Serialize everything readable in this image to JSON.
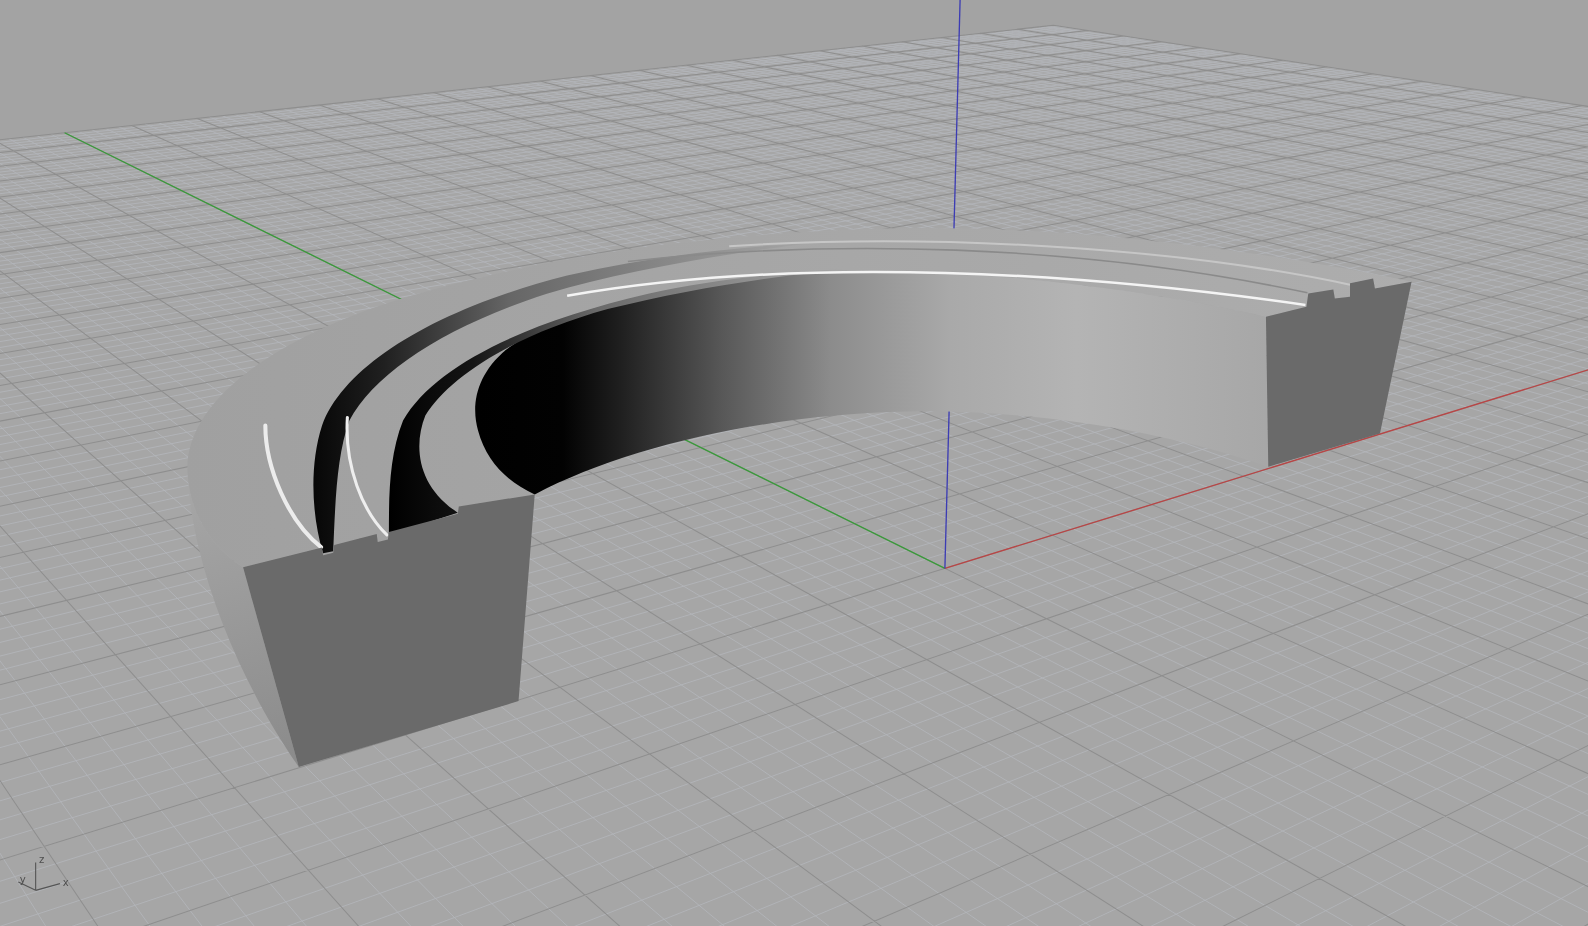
{
  "viewport": {
    "axis_gizmo": {
      "axes": [
        {
          "kind": "z",
          "label": "z"
        },
        {
          "kind": "y",
          "label": "y"
        },
        {
          "kind": "x",
          "label": "x"
        }
      ]
    }
  }
}
